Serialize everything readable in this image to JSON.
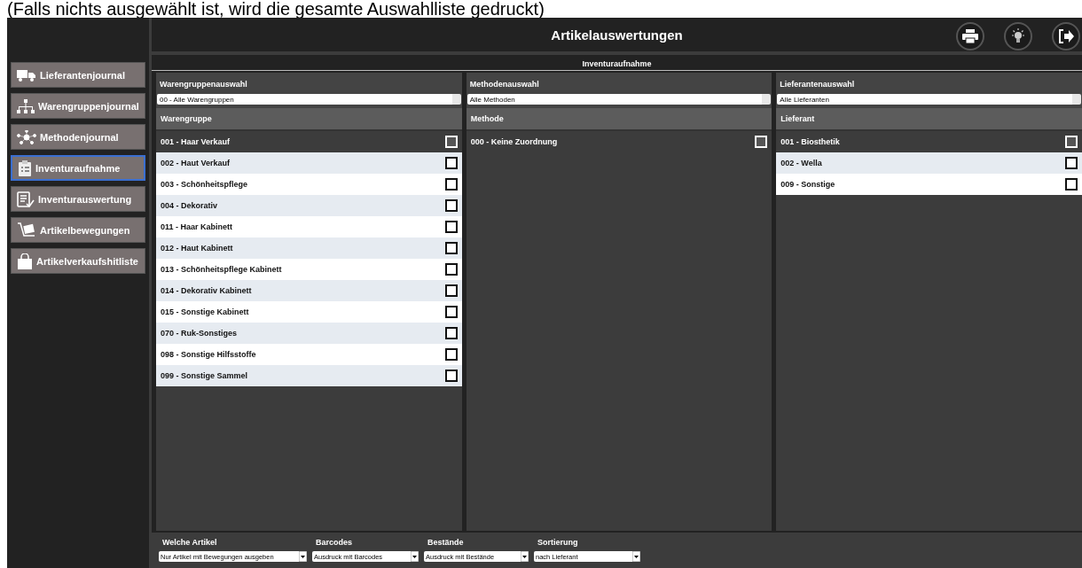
{
  "caption": "(Falls nichts ausgewählt ist, wird die gesamte Auswahlliste gedruckt)",
  "sidebar": {
    "items": [
      {
        "label": "Lieferantenjournal",
        "selected": false
      },
      {
        "label": "Warengruppenjournal",
        "selected": false
      },
      {
        "label": "Methodenjournal",
        "selected": false
      },
      {
        "label": "Inventuraufnahme",
        "selected": true
      },
      {
        "label": "Inventurauswertung",
        "selected": false
      },
      {
        "label": "Artikelbewegungen",
        "selected": false
      },
      {
        "label": "Artikelverkaufshitliste",
        "selected": false
      }
    ]
  },
  "header": {
    "title": "Artikelauswertungen"
  },
  "section_title": "Inventuraufnahme",
  "columns": [
    {
      "label": "Warengruppenauswahl",
      "select": "00 - Alle Warengruppen",
      "list_header": "Warengruppe",
      "rows": [
        {
          "text": "001 - Haar Verkauf",
          "selected": true,
          "checked": false
        },
        {
          "text": "002 - Haut Verkauf",
          "selected": false,
          "checked": false
        },
        {
          "text": "003 - Schönheitspflege",
          "selected": false,
          "checked": false
        },
        {
          "text": "004 - Dekorativ",
          "selected": false,
          "checked": false
        },
        {
          "text": "011 - Haar Kabinett",
          "selected": false,
          "checked": false
        },
        {
          "text": "012 - Haut Kabinett",
          "selected": false,
          "checked": false
        },
        {
          "text": "013 - Schönheitspflege Kabinett",
          "selected": false,
          "checked": false
        },
        {
          "text": "014 - Dekorativ Kabinett",
          "selected": false,
          "checked": false
        },
        {
          "text": "015 - Sonstige Kabinett",
          "selected": false,
          "checked": false
        },
        {
          "text": "070 - Ruk-Sonstiges",
          "selected": false,
          "checked": false
        },
        {
          "text": "098 - Sonstige Hilfsstoffe",
          "selected": false,
          "checked": false
        },
        {
          "text": "099 - Sonstige Sammel",
          "selected": false,
          "checked": false
        }
      ]
    },
    {
      "label": "Methodenauswahl",
      "select": "Alle Methoden",
      "list_header": "Methode",
      "rows": [
        {
          "text": "000 - Keine Zuordnung",
          "selected": true,
          "checked": false
        }
      ]
    },
    {
      "label": "Lieferantenauswahl",
      "select": "Alle Lieferanten",
      "list_header": "Lieferant",
      "rows": [
        {
          "text": "001 - Biosthetik",
          "selected": true,
          "checked": false
        },
        {
          "text": "002 - Wella",
          "selected": false,
          "checked": false
        },
        {
          "text": "009 - Sonstige",
          "selected": false,
          "checked": false
        }
      ]
    }
  ],
  "options": [
    {
      "label": "Welche Artikel",
      "value": "Nur Artikel mit Bewegungen ausgeben"
    },
    {
      "label": "Barcodes",
      "value": "Ausdruck mit Barcodes"
    },
    {
      "label": "Bestände",
      "value": "Ausdruck mit Bestände"
    },
    {
      "label": "Sortierung",
      "value": "nach Lieferant"
    }
  ]
}
